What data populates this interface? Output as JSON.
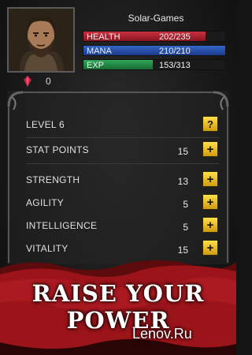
{
  "player": {
    "name": "Solar-Games",
    "gems": "0"
  },
  "bars": {
    "health": {
      "label": "HEALTH",
      "value": "202/235",
      "current": 202,
      "max": 235
    },
    "mana": {
      "label": "MANA",
      "value": "210/210",
      "current": 210,
      "max": 210
    },
    "exp": {
      "label": "EXP",
      "value": "153/313",
      "current": 153,
      "max": 313
    }
  },
  "stats": {
    "level": {
      "label": "LEVEL 6"
    },
    "stat_points": {
      "label": "STAT POINTS",
      "value": "15"
    },
    "strength": {
      "label": "STRENGTH",
      "value": "13"
    },
    "agility": {
      "label": "AGILITY",
      "value": "5"
    },
    "intelligence": {
      "label": "INTELLIGENCE",
      "value": "5"
    },
    "vitality": {
      "label": "VITALITY",
      "value": "15"
    }
  },
  "buttons": {
    "help": "?",
    "plus": "+"
  },
  "banner": {
    "line1": "RAISE YOUR",
    "line2": "POWER"
  },
  "watermark": "Lenov.Ru",
  "colors": {
    "health": "#c8313d",
    "mana": "#3466c8",
    "exp": "#2fa85a",
    "button": "#f2c52a",
    "banner": "#8a1216"
  }
}
